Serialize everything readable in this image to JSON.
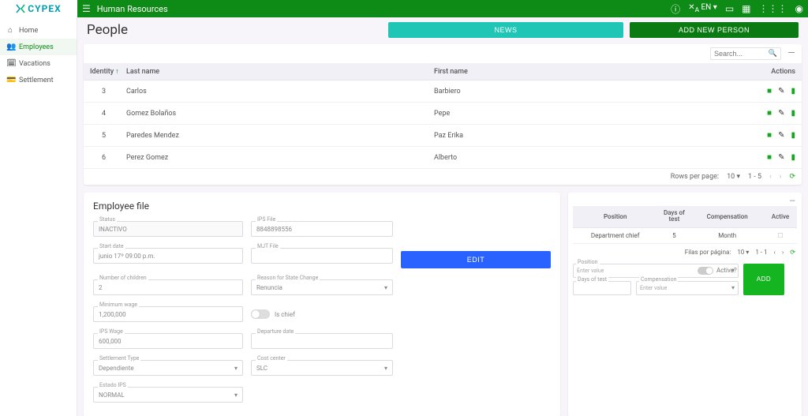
{
  "brand": "CYPEX",
  "breadcrumb": "Human Resources",
  "lang_label": "EN",
  "sidebar": {
    "items": [
      {
        "label": "Home"
      },
      {
        "label": "Employees"
      },
      {
        "label": "Vacations"
      },
      {
        "label": "Settlement"
      }
    ]
  },
  "page": {
    "title": "People",
    "news_btn": "NEWS",
    "add_person_btn": "ADD NEW PERSON"
  },
  "search": {
    "placeholder": "Search..."
  },
  "table": {
    "columns": {
      "identity": "Identity",
      "last": "Last name",
      "first": "First name",
      "actions": "Actions"
    },
    "rows": [
      {
        "id": "3",
        "last": "Carlos",
        "first": "Barbiero"
      },
      {
        "id": "4",
        "last": "Gomez Bolaños",
        "first": "Pepe"
      },
      {
        "id": "5",
        "last": "Paredes Mendez",
        "first": "Paz Erika"
      },
      {
        "id": "6",
        "last": "Perez Gomez",
        "first": "Alberto"
      }
    ],
    "paginator": {
      "rpp_label": "Rows per page:",
      "rpp": "10",
      "range": "1 - 5"
    }
  },
  "employee_file": {
    "title": "Employee file",
    "edit_btn": "EDIT",
    "status_label": "Status",
    "status_value": "INACTIVO",
    "ips_file_label": "IPS File",
    "ips_file_value": "8848898556",
    "start_date_label": "Start date",
    "start_date_value": "junio 17º 09:00 p.m.",
    "mjt_label": "MJT File",
    "mjt_value": "",
    "children_label": "Number of children",
    "children_value": "2",
    "reason_label": "Reason for State Change",
    "reason_value": "Renuncia",
    "min_wage_label": "Minimum wage",
    "min_wage_value": "1,200,000",
    "is_chief_label": "Is chief",
    "ips_wage_label": "IPS Wage",
    "ips_wage_value": "600,000",
    "departure_label": "Departure date",
    "settlement_type_label": "Settlement Type",
    "settlement_type_value": "Dependiente",
    "cost_center_label": "Cost center",
    "cost_center_value": "SLC",
    "estado_ips_label": "Estado IPS",
    "estado_ips_value": "NORMAL"
  },
  "positions": {
    "columns": {
      "position": "Position",
      "days": "Days of test",
      "compensation": "Compensation",
      "active": "Active"
    },
    "rows": [
      {
        "position": "Department chief",
        "days": "5",
        "compensation": "Month"
      }
    ],
    "paginator": {
      "rpp_label": "Filas por página:",
      "rpp": "10",
      "range": "1 - 1"
    },
    "form": {
      "position_label": "Position",
      "position_placeholder": "Enter value",
      "days_label": "Days of test",
      "comp_label": "Compensation",
      "comp_placeholder": "Enter value",
      "active_label": "Active?",
      "add_btn": "ADD"
    }
  }
}
